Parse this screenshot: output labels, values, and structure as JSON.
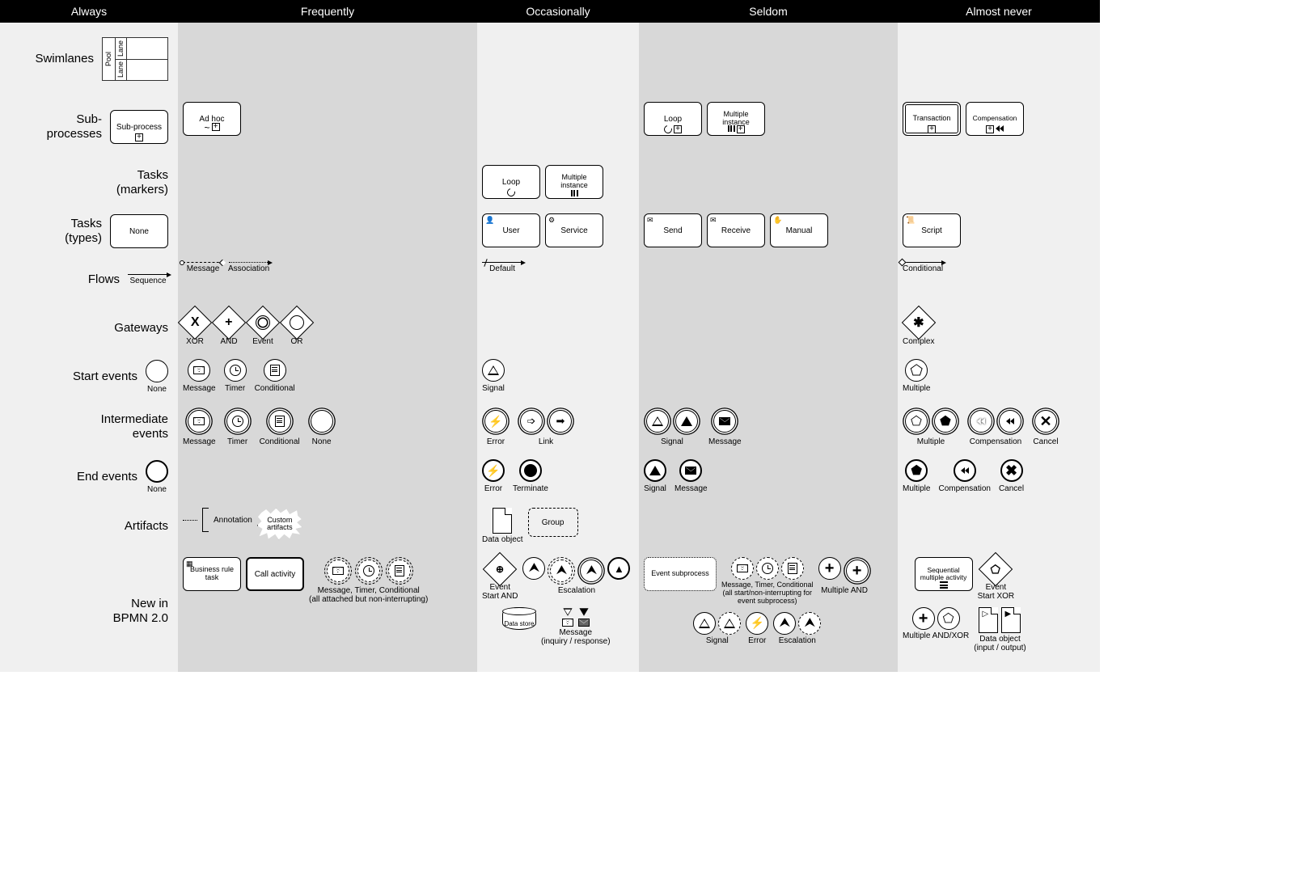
{
  "columns": [
    "Always",
    "Frequently",
    "Occasionally",
    "Seldom",
    "Almost never"
  ],
  "rows": {
    "swimlanes": "Swimlanes",
    "subprocesses": "Sub-\nprocesses",
    "tasks_markers": "Tasks\n(markers)",
    "tasks_types": "Tasks\n(types)",
    "flows": "Flows",
    "gateways": "Gateways",
    "start_events": "Start events",
    "intermediate_events": "Intermediate\nevents",
    "end_events": "End events",
    "artifacts": "Artifacts",
    "new_bpmn": "New in\nBPMN 2.0"
  },
  "swimlane": {
    "pool": "Pool",
    "lane": "Lane"
  },
  "subprocess": {
    "sub": "Sub-process",
    "adhoc": "Ad hoc",
    "loop": "Loop",
    "multiple": "Multiple instance",
    "transaction": "Transaction",
    "compensation": "Compensation"
  },
  "tasks_markers": {
    "loop": "Loop",
    "multiple": "Multiple instance"
  },
  "tasks_types": {
    "none": "None",
    "user": "User",
    "service": "Service",
    "send": "Send",
    "receive": "Receive",
    "manual": "Manual",
    "script": "Script"
  },
  "flows": {
    "sequence": "Sequence",
    "message": "Message",
    "association": "Association",
    "default": "Default",
    "conditional": "Conditional"
  },
  "gateways": {
    "xor": "XOR",
    "and": "AND",
    "event": "Event",
    "or": "OR",
    "complex": "Complex"
  },
  "start": {
    "none": "None",
    "message": "Message",
    "timer": "Timer",
    "conditional": "Conditional",
    "signal": "Signal",
    "multiple": "Multiple"
  },
  "intermediate": {
    "message": "Message",
    "timer": "Timer",
    "conditional": "Conditional",
    "none": "None",
    "error": "Error",
    "link": "Link",
    "signal": "Signal",
    "msg_throw": "Message",
    "multiple": "Multiple",
    "compensation": "Compensation",
    "cancel": "Cancel"
  },
  "end": {
    "none": "None",
    "error": "Error",
    "terminate": "Terminate",
    "signal": "Signal",
    "message": "Message",
    "multiple": "Multiple",
    "compensation": "Compensation",
    "cancel": "Cancel"
  },
  "artifacts": {
    "annotation": "Annotation",
    "custom": "Custom artifacts",
    "data_object": "Data object",
    "group": "Group"
  },
  "bpmn20": {
    "business_rule": "Business rule task",
    "call_activity": "Call activity",
    "attached_caption": "Message, Timer, Conditional\n(all attached but non-interrupting)",
    "event_start_and": "Event\nStart AND",
    "escalation": "Escalation",
    "event_subprocess": "Event subprocess",
    "start_caption": "Message, Timer, Conditional\n(all start/non-interrupting for\nevent subprocess)",
    "multiple_and": "Multiple AND",
    "seq_multi": "Sequential multiple activity",
    "event_start_xor": "Event\nStart XOR",
    "data_store": "Data store",
    "msg_inq_resp": "Message\n(inquiry / response)",
    "signal": "Signal",
    "error": "Error",
    "escalation2": "Escalation",
    "multiple_and_xor": "Multiple AND/XOR",
    "data_obj_io": "Data object\n(input / output)"
  }
}
